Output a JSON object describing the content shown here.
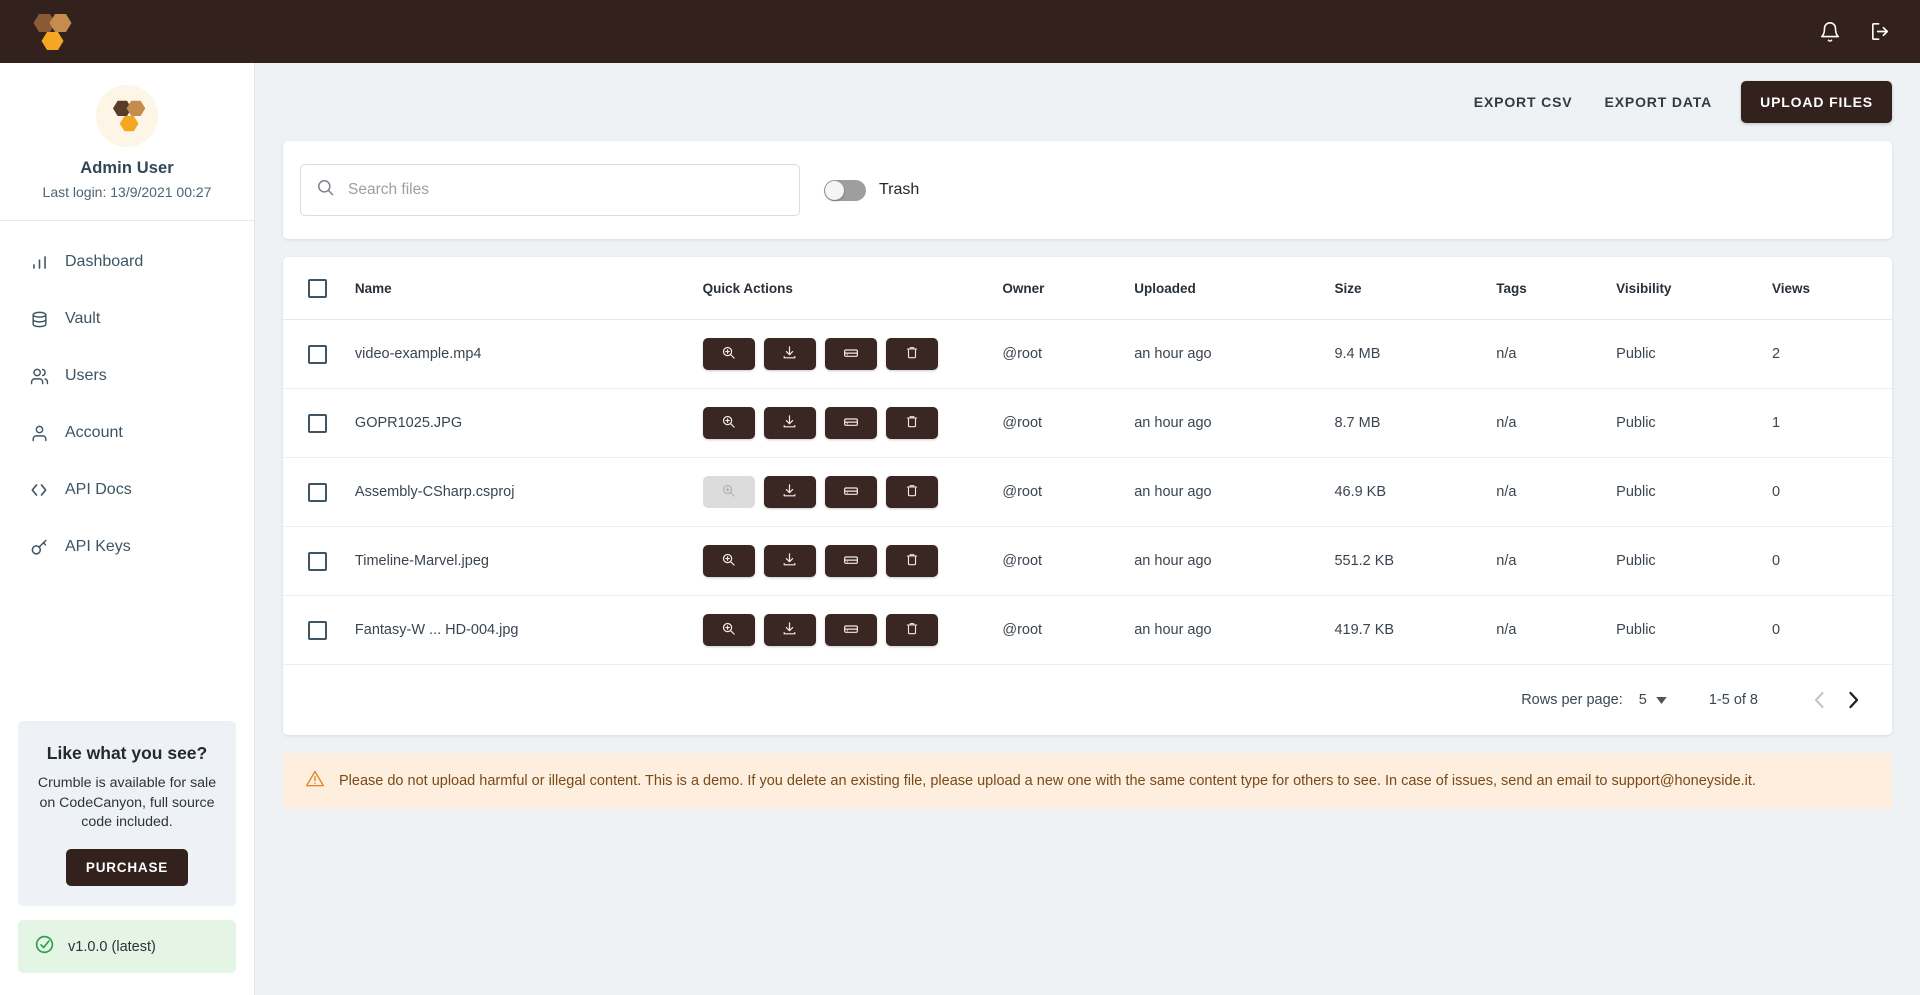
{
  "topbar": {
    "logo": "honeycomb-logo",
    "icons": [
      {
        "name": "notifications-icon",
        "glyph": "bell"
      },
      {
        "name": "logout-icon",
        "glyph": "logout"
      }
    ]
  },
  "sidebar": {
    "profile": {
      "avatar": "honeycomb-avatar",
      "name": "Admin User",
      "last_login": "Last login: 13/9/2021 00:27"
    },
    "nav": [
      {
        "label": "Dashboard",
        "icon": "bar-chart-icon"
      },
      {
        "label": "Vault",
        "icon": "database-icon"
      },
      {
        "label": "Users",
        "icon": "users-icon"
      },
      {
        "label": "Account",
        "icon": "person-icon"
      },
      {
        "label": "API Docs",
        "icon": "code-brackets-icon"
      },
      {
        "label": "API Keys",
        "icon": "key-icon"
      }
    ],
    "promo": {
      "title": "Like what you see?",
      "body": "Crumble is available for sale on CodeCanyon, full source code included.",
      "button": "PURCHASE"
    },
    "version": {
      "label": "v1.0.0 (latest)",
      "icon": "check-circle-icon"
    }
  },
  "header_actions": {
    "export_csv": "EXPORT CSV",
    "export_data": "EXPORT DATA",
    "upload_files": "UPLOAD FILES"
  },
  "search": {
    "placeholder": "Search files",
    "value": "",
    "icon": "search-icon"
  },
  "trash_toggle": {
    "label": "Trash",
    "state": "off"
  },
  "table": {
    "columns": [
      "Name",
      "Quick Actions",
      "Owner",
      "Uploaded",
      "Size",
      "Tags",
      "Visibility",
      "Views"
    ],
    "quick_action_icons": [
      "zoom-in-icon",
      "download-icon",
      "drive-icon",
      "trash-icon"
    ],
    "rows": [
      {
        "name": "video-example.mp4",
        "owner": "@root",
        "uploaded": "an hour ago",
        "size": "9.4 MB",
        "tags": "n/a",
        "visibility": "Public",
        "views": "2",
        "preview_disabled": false
      },
      {
        "name": "GOPR1025.JPG",
        "owner": "@root",
        "uploaded": "an hour ago",
        "size": "8.7 MB",
        "tags": "n/a",
        "visibility": "Public",
        "views": "1",
        "preview_disabled": false
      },
      {
        "name": "Assembly-CSharp.csproj",
        "owner": "@root",
        "uploaded": "an hour ago",
        "size": "46.9 KB",
        "tags": "n/a",
        "visibility": "Public",
        "views": "0",
        "preview_disabled": true
      },
      {
        "name": "Timeline-Marvel.jpeg",
        "owner": "@root",
        "uploaded": "an hour ago",
        "size": "551.2 KB",
        "tags": "n/a",
        "visibility": "Public",
        "views": "0",
        "preview_disabled": false
      },
      {
        "name": "Fantasy-W ... HD-004.jpg",
        "owner": "@root",
        "uploaded": "an hour ago",
        "size": "419.7 KB",
        "tags": "n/a",
        "visibility": "Public",
        "views": "0",
        "preview_disabled": false
      }
    ]
  },
  "pagination": {
    "rows_per_page_label": "Rows per page:",
    "rows_per_page_value": "5",
    "range": "1-5 of 8",
    "prev_enabled": false,
    "next_enabled": true
  },
  "warning": {
    "icon": "warning-triangle-icon",
    "text": "Please do not upload harmful or illegal content. This is a demo. If you delete an existing file, please upload a new one with the same content type for others to see. In case of issues, send an email to support@honeyside.it."
  },
  "colors": {
    "brand_dark": "#33211e",
    "accent_gold": "#f5a623",
    "page_bg": "#eef2f5",
    "warn_bg": "#fdeede",
    "warn_text": "#7a4a17",
    "version_bg": "#e4f5e6"
  }
}
